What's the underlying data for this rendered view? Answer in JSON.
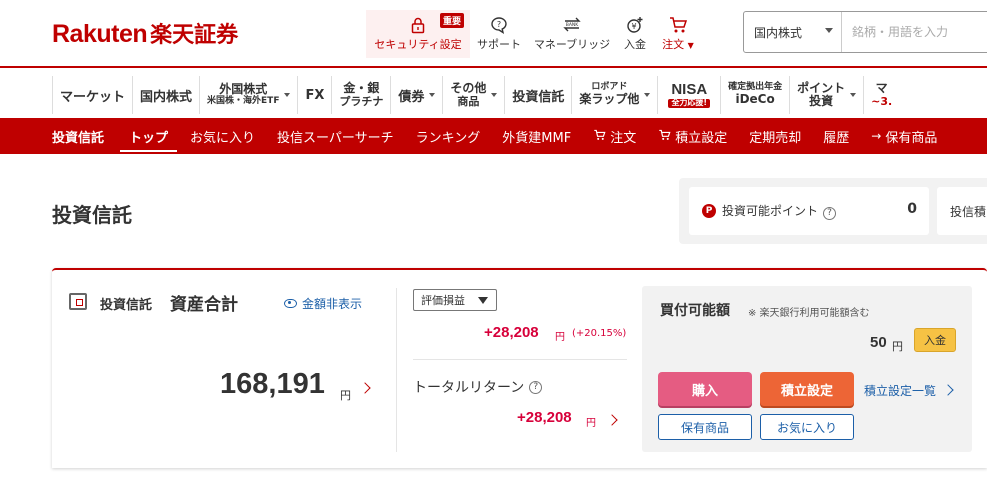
{
  "header": {
    "logo_en": "Rakuten",
    "logo_ja": "楽天証券",
    "security_label": "セキュリティ設定",
    "security_badge": "重要",
    "support_label": "サポート",
    "bridge_label": "マネーブリッジ",
    "deposit_label": "入金",
    "order_label": "注文",
    "search": {
      "select_value": "国内株式",
      "placeholder": "銘柄・用語を入力"
    }
  },
  "main_nav": {
    "market": "マーケット",
    "domestic": "国内株式",
    "foreign_l1": "外国株式",
    "foreign_l2": "米国株・海外ETF",
    "fx": "FX",
    "gold_l1": "金・銀",
    "gold_l2": "プラチナ",
    "bonds": "債券",
    "other_l1": "その他",
    "other_l2": "商品",
    "funds": "投資信託",
    "robo_l1": "ロボアド",
    "robo_l2": "楽ラップ他",
    "nisa": "NISA",
    "nisa_badge": "全力応援!",
    "ideco_l1": "確定拠出年金",
    "ideco_l2": "iDeCo",
    "points_l1": "ポイント",
    "points_l2": "投資",
    "margin_l1": "マ",
    "margin_l2": "~3."
  },
  "sub_nav": {
    "section": "投資信託",
    "items": [
      "トップ",
      "お気に入り",
      "投信スーパーサーチ",
      "ランキング",
      "外貨建MMF",
      "注文",
      "積立設定",
      "定期売却",
      "履歴",
      "保有商品"
    ],
    "active_index": 0
  },
  "page": {
    "title": "投資信託",
    "points_label": "投資可能ポイント",
    "points_value": "0",
    "points_label2": "投信積"
  },
  "asset": {
    "label": "投資信託",
    "title": "資産合計",
    "hide_label": "金額非表示",
    "total": "168,191",
    "unit": "円",
    "eval_select": "評価損益",
    "eval_value": "+28,208",
    "eval_unit": "円",
    "eval_pct": "(+20.15%)",
    "total_return_label": "トータルリターン",
    "total_return_value": "+28,208",
    "total_return_unit": "円"
  },
  "buy_panel": {
    "title": "買付可能額",
    "note": "※ 楽天銀行利用可能額含む",
    "value": "50",
    "unit": "円",
    "deposit_btn": "入金",
    "buy_btn": "購入",
    "tsumi_btn": "積立設定",
    "tsumi_list": "積立設定一覧",
    "holdings_btn": "保有商品",
    "favorite_btn": "お気に入り"
  },
  "colors": {
    "brand": "#bf0000",
    "gain": "#d7003a",
    "link": "#1c5fa8",
    "buy": "#e55c82",
    "tsumi": "#ed6536",
    "deposit": "#f6c244"
  }
}
